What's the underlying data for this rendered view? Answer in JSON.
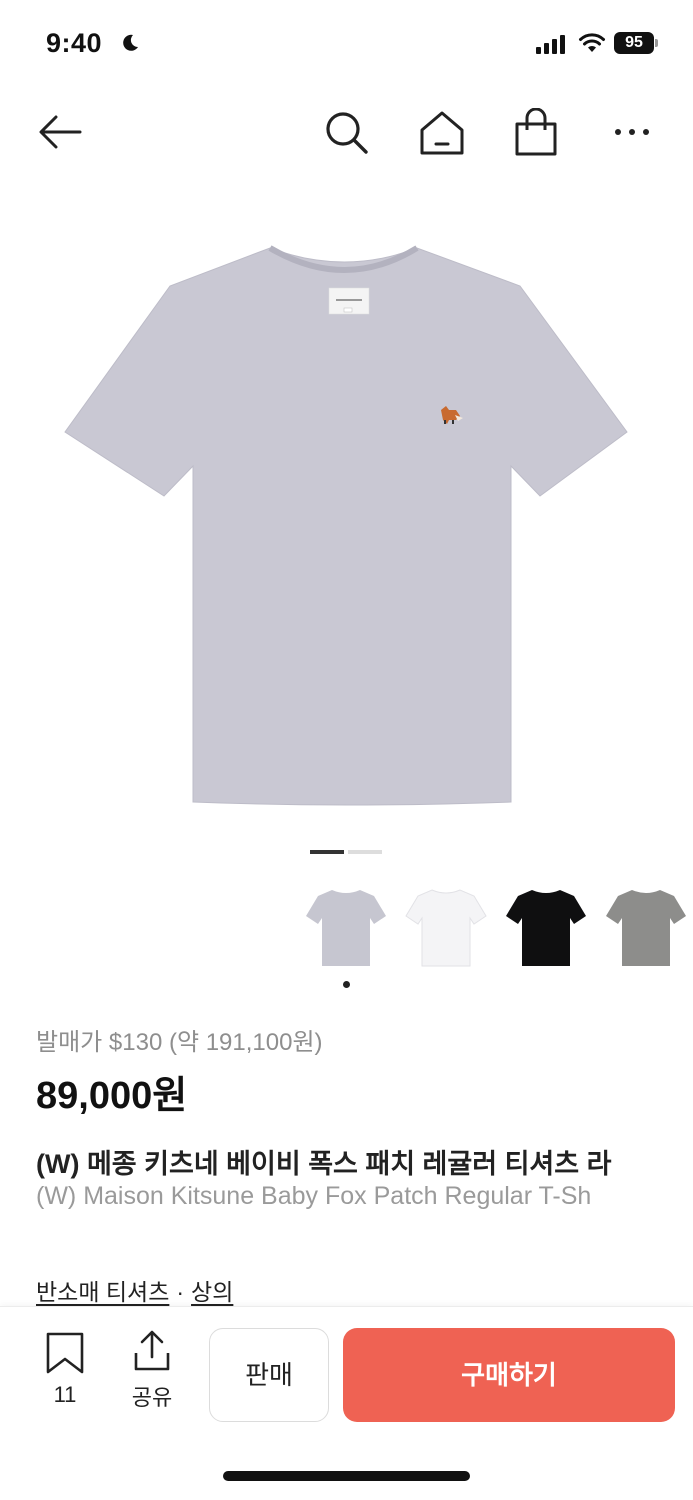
{
  "status_bar": {
    "time": "9:40",
    "battery": "95",
    "icons": [
      "moon-icon",
      "signal-icon",
      "wifi-icon",
      "battery-icon"
    ]
  },
  "nav": {
    "icons": [
      "back-arrow-icon",
      "search-icon",
      "home-icon",
      "shopping-bag-icon",
      "more-icon"
    ]
  },
  "product": {
    "image_colors": {
      "tshirt": "#c9c8d3",
      "background": "#ffffff"
    },
    "pager": {
      "active_index": 0,
      "total": 2
    },
    "thumbnails": [
      {
        "color_name": "gray",
        "fill": "#c6c6d0"
      },
      {
        "color_name": "white",
        "fill": "#f4f4f6"
      },
      {
        "color_name": "black",
        "fill": "#0f0f10"
      },
      {
        "color_name": "dark-gray",
        "fill": "#8d8d8b"
      }
    ],
    "selected_thumbnail": 0,
    "release_price": "발매가 $130 (약 191,100원)",
    "price": "89,000원",
    "title_ko": "(W) 메종 키츠네 베이비 폭스 패치 레귤러 티셔츠 라",
    "title_en": "(W) Maison Kitsune Baby Fox Patch Regular T-Sh",
    "category": {
      "primary": "반소매 티셔츠",
      "separator": "·",
      "secondary": "상의"
    }
  },
  "bottom_bar": {
    "wish_count": "11",
    "share_label": "공유",
    "sell_label": "판매",
    "buy_label": "구매하기",
    "buy_color": "#ef6253"
  }
}
